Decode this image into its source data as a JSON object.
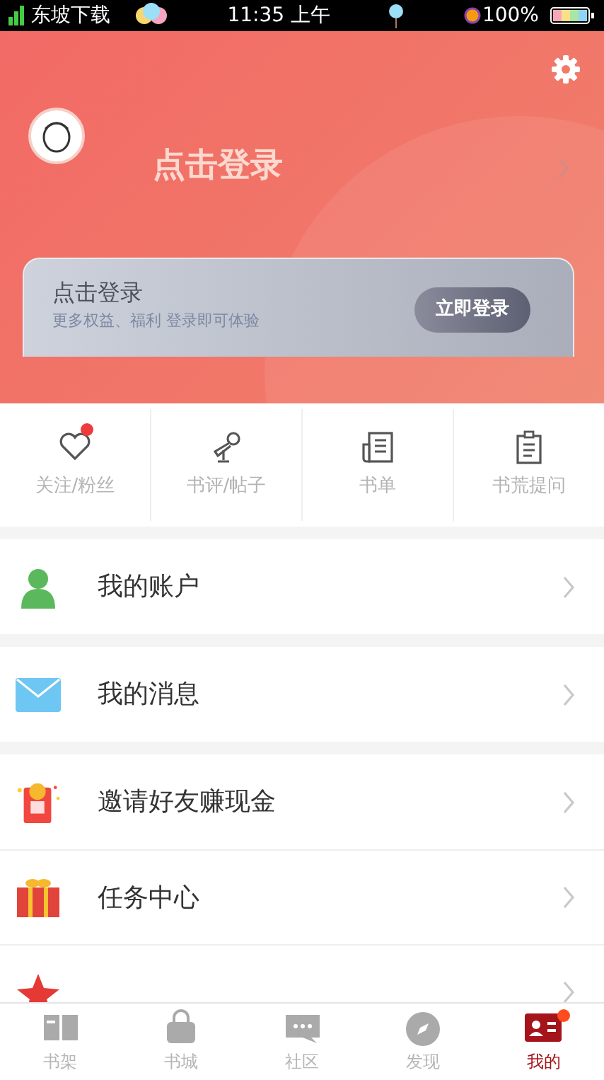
{
  "status_bar": {
    "carrier": "东坡下载",
    "time": "11:35 上午",
    "battery": "100%"
  },
  "header": {
    "login_text": "点击登录"
  },
  "login_card": {
    "title": "点击登录",
    "subtitle": "更多权益、福利 登录即可体验",
    "button": "立即登录"
  },
  "shortcuts": [
    {
      "kind": "heart",
      "label": "关注/粉丝",
      "badge": true
    },
    {
      "kind": "mic",
      "label": "书评/帖子",
      "badge": false
    },
    {
      "kind": "list",
      "label": "书单",
      "badge": false
    },
    {
      "kind": "clipboard",
      "label": "书荒提问",
      "badge": false
    }
  ],
  "menu_groups": [
    [
      {
        "kind": "account",
        "label": "我的账户"
      }
    ],
    [
      {
        "kind": "message",
        "label": "我的消息"
      }
    ],
    [
      {
        "kind": "invite",
        "label": "邀请好友赚现金"
      },
      {
        "kind": "task",
        "label": "任务中心"
      },
      {
        "kind": "level"
      }
    ]
  ],
  "tabs": [
    {
      "kind": "shelf",
      "label": "书架",
      "selected": false,
      "badge": false
    },
    {
      "kind": "store",
      "label": "书城",
      "selected": false,
      "badge": false
    },
    {
      "kind": "community",
      "label": "社区",
      "selected": false,
      "badge": false
    },
    {
      "kind": "discover",
      "label": "发现",
      "selected": false,
      "badge": false
    },
    {
      "kind": "me",
      "label": "我的",
      "selected": true,
      "badge": true
    }
  ]
}
